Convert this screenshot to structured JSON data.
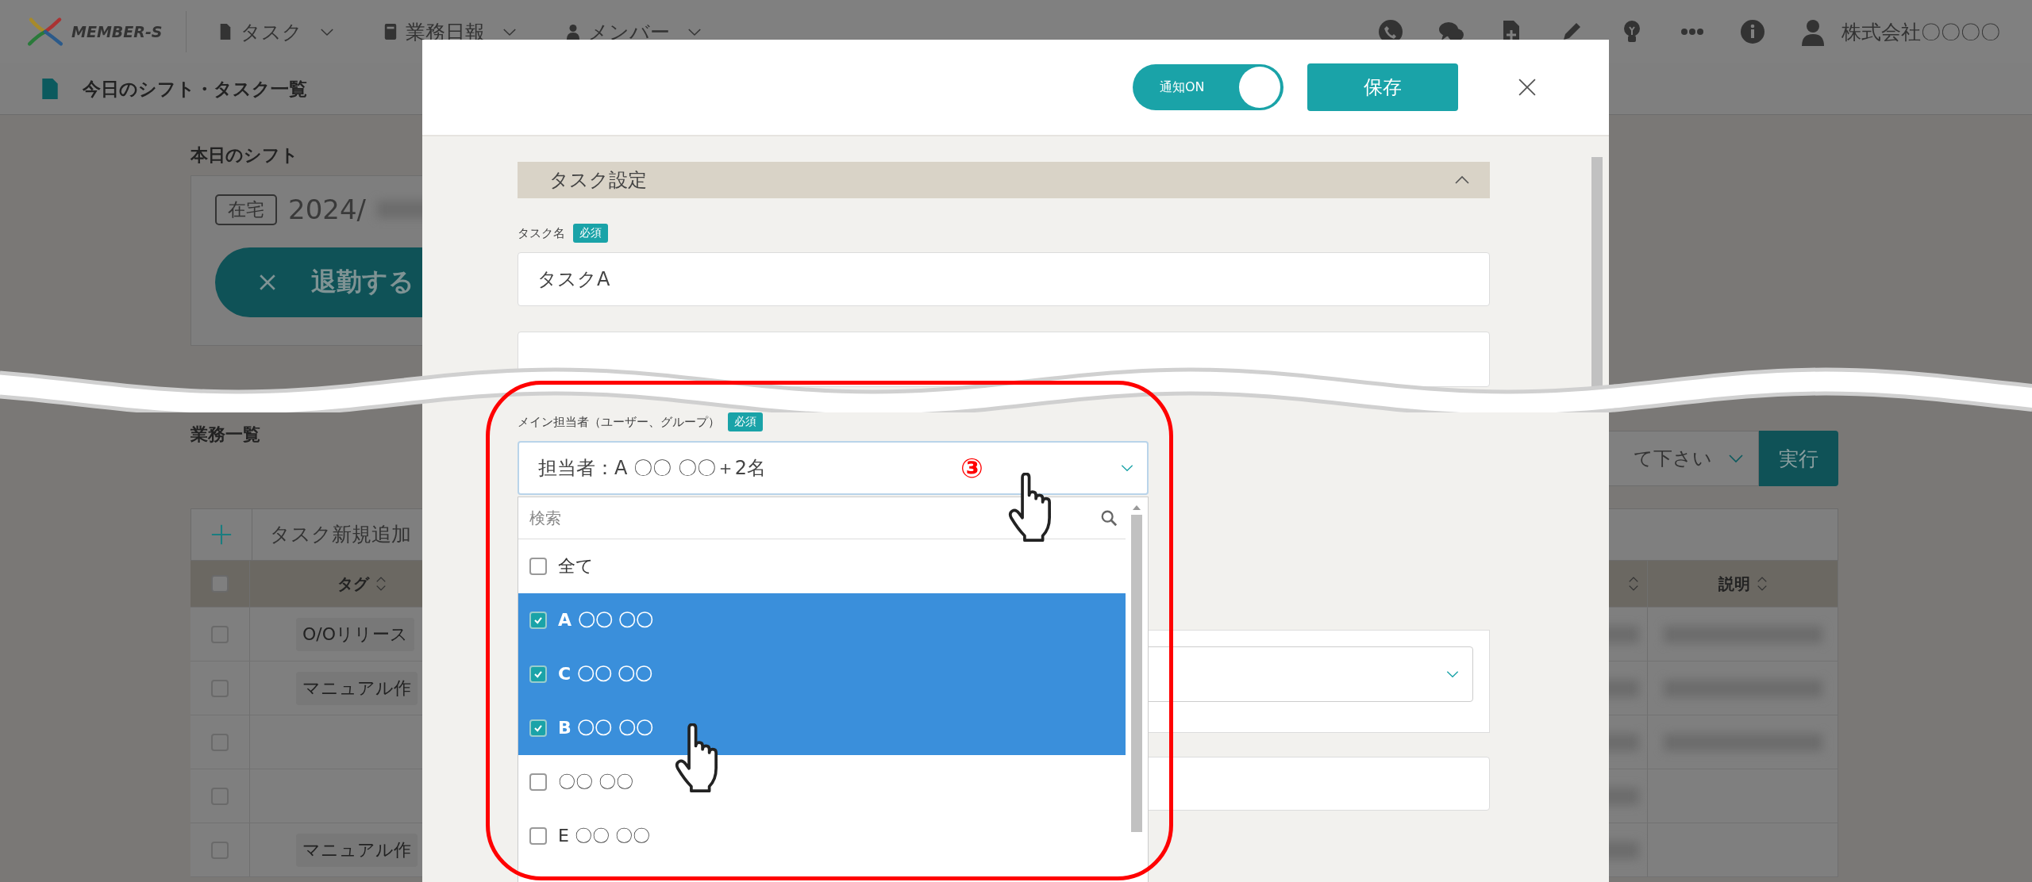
{
  "header": {
    "logo": "MEMBER-S",
    "nav": [
      {
        "label": "タスク"
      },
      {
        "label": "業務日報"
      },
      {
        "label": "メンバー"
      }
    ],
    "company": "株式会社〇〇〇〇"
  },
  "page_title": "今日のシフト・タスク一覧",
  "shift": {
    "heading": "本日のシフト",
    "badge": "在宅",
    "date": "2024/",
    "button": "退勤する"
  },
  "tasks": {
    "heading": "業務一覧",
    "bulk_select": "て下さい",
    "run_button": "実行",
    "add_label": "タスク新規追加",
    "header_checked": false,
    "columns": [
      {
        "label": "タグ"
      },
      {
        "label": "説明"
      }
    ],
    "rows": [
      {
        "tag": "O/Oリリース",
        "checked": false,
        "redacted": true
      },
      {
        "tag": "マニュアル作",
        "checked": false,
        "redacted": true
      },
      {
        "checked": false,
        "redacted": true
      },
      {
        "checked": false,
        "redacted": false
      },
      {
        "tag": "マニュアル作",
        "checked": false,
        "redacted": false
      }
    ]
  },
  "modal": {
    "toggle": {
      "label": "通知ON",
      "on": true
    },
    "save_button": "保存",
    "section": {
      "title": "タスク設定",
      "expanded": true
    },
    "task_name": {
      "label": "タスク名",
      "required": "必須",
      "value": "タスクA"
    },
    "assignee": {
      "label": "メイン担当者（ユーザー、グループ）",
      "required": "必須",
      "value": "担当者：A 〇〇 〇〇＋2名",
      "dropdown": {
        "placeholder": "検索",
        "options": [
          {
            "label": "全て",
            "checked": false,
            "selected": false
          },
          {
            "label": "A 〇〇 〇〇",
            "checked": true,
            "selected": true
          },
          {
            "label": "C 〇〇 〇〇",
            "checked": true,
            "selected": true
          },
          {
            "label": "B 〇〇 〇〇",
            "checked": true,
            "selected": true
          },
          {
            "label": "〇〇 〇〇",
            "checked": false,
            "selected": false
          },
          {
            "label": "E 〇〇 〇〇",
            "checked": false,
            "selected": false
          }
        ]
      }
    }
  },
  "annotation": {
    "step": "③"
  }
}
